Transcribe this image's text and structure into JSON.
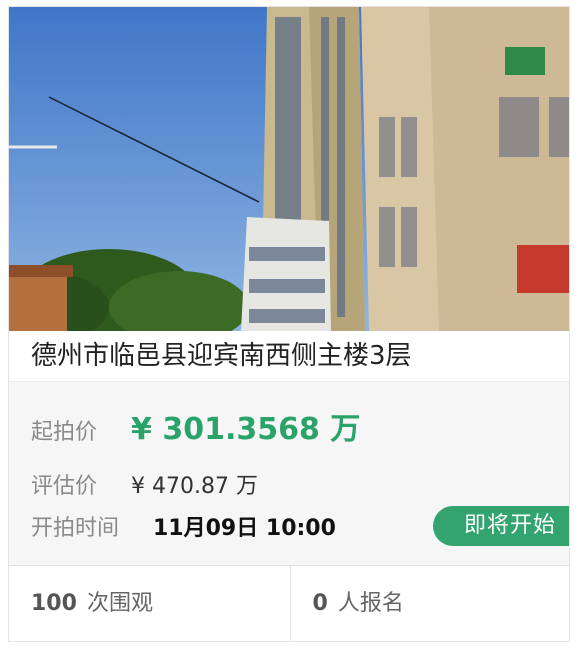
{
  "listing": {
    "title": "德州市临邑县迎宾南西侧主楼3层",
    "start_price_label": "起拍价",
    "start_price_value": "¥ 301.3568 万",
    "eval_price_label": "评估价",
    "eval_price_value": "¥ 470.87 万",
    "start_time_label": "开拍时间",
    "start_time_value": "11月09日 10:00",
    "status_badge": "即将开始"
  },
  "stats": {
    "views_count": "100",
    "views_label": "次围观",
    "signups_count": "0",
    "signups_label": "人报名"
  },
  "colors": {
    "accent_green": "#2aa36b",
    "badge_green": "#33a36f"
  }
}
